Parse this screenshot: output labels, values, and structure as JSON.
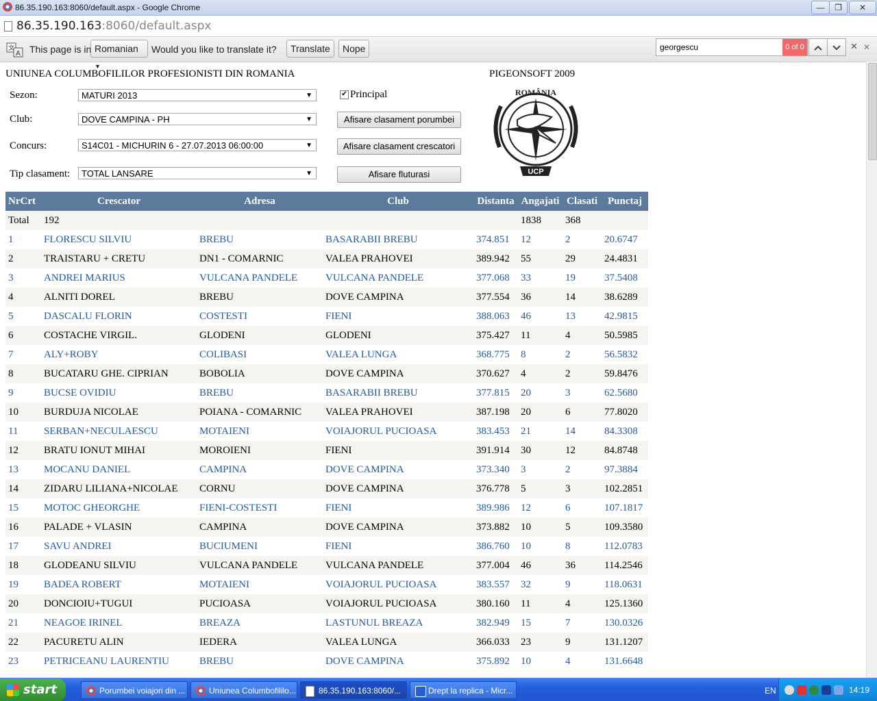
{
  "window": {
    "title": "86.35.190.163:8060/default.aspx - Google Chrome",
    "minimize": "—",
    "restore": "❐",
    "close": "✕"
  },
  "urlbar": {
    "host": "86.35.190.163",
    "path": ":8060/default.aspx"
  },
  "translate": {
    "prefix": "This page is in",
    "language": "Romanian",
    "question": "Would you like to translate it?",
    "translate_label": "Translate",
    "nope_label": "Nope"
  },
  "find": {
    "query": "georgescu",
    "count": "0 of 0",
    "close": "✕"
  },
  "header": {
    "org": "UNIUNEA COLUMBOFILILOR PROFESIONISTI DIN ROMANIA",
    "software": "PIGEONSOFT 2009"
  },
  "form": {
    "sezon_label": "Sezon:",
    "sezon_value": "MATURI 2013",
    "club_label": "Club:",
    "club_value": "DOVE CAMPINA - PH",
    "concurs_label": "Concurs:",
    "concurs_value": "S14C01 - MICHURIN 6 - 27.07.2013 06:00:00",
    "tip_label": "Tip clasament:",
    "tip_value": "TOTAL LANSARE",
    "principal_label": "Principal",
    "principal_checked": true,
    "btn_porumbei": "Afisare clasament porumbei",
    "btn_crescatori": "Afisare clasament crescatori",
    "btn_fluturasi": "Afisare fluturasi"
  },
  "logo": {
    "top_text": "ROMÂNIA",
    "bottom_text": "UCP"
  },
  "table": {
    "headers": [
      "NrCrt",
      "Crescator",
      "Adresa",
      "Club",
      "Distanta",
      "Angajati",
      "Clasati",
      "Punctaj"
    ],
    "total": {
      "label": "Total",
      "count": "192",
      "angajati": "1838",
      "clasati": "368"
    },
    "rows": [
      [
        "1",
        "FLORESCU SILVIU",
        "BREBU",
        "BASARABII BREBU",
        "374.851",
        "12",
        "2",
        "20.6747"
      ],
      [
        "2",
        "TRAISTARU + CRETU",
        "DN1 - COMARNIC",
        "VALEA PRAHOVEI",
        "389.942",
        "55",
        "29",
        "24.4831"
      ],
      [
        "3",
        "ANDREI MARIUS",
        "VULCANA PANDELE",
        "VULCANA PANDELE",
        "377.068",
        "33",
        "19",
        "37.5408"
      ],
      [
        "4",
        "ALNITI DOREL",
        "BREBU",
        "DOVE CAMPINA",
        "377.554",
        "36",
        "14",
        "38.6289"
      ],
      [
        "5",
        "DASCALU FLORIN",
        "COSTESTI",
        "FIENI",
        "388.063",
        "46",
        "13",
        "42.9815"
      ],
      [
        "6",
        "COSTACHE VIRGIL.",
        "GLODENI",
        "GLODENI",
        "375.427",
        "11",
        "4",
        "50.5985"
      ],
      [
        "7",
        "ALY+ROBY",
        "COLIBASI",
        "VALEA LUNGA",
        "368.775",
        "8",
        "2",
        "56.5832"
      ],
      [
        "8",
        "BUCATARU GHE. CIPRIAN",
        "BOBOLIA",
        "DOVE CAMPINA",
        "370.627",
        "4",
        "2",
        "59.8476"
      ],
      [
        "9",
        "BUCSE OVIDIU",
        "BREBU",
        "BASARABII BREBU",
        "377.815",
        "20",
        "3",
        "62.5680"
      ],
      [
        "10",
        "BURDUJA NICOLAE",
        "POIANA - COMARNIC",
        "VALEA PRAHOVEI",
        "387.198",
        "20",
        "6",
        "77.8020"
      ],
      [
        "11",
        "SERBAN+NECULAESCU",
        "MOTAIENI",
        "VOIAJORUL PUCIOASA",
        "383.453",
        "21",
        "14",
        "84.3308"
      ],
      [
        "12",
        "BRATU IONUT MIHAI",
        "MOROIENI",
        "FIENI",
        "391.914",
        "30",
        "12",
        "84.8748"
      ],
      [
        "13",
        "MOCANU DANIEL",
        "CAMPINA",
        "DOVE CAMPINA",
        "373.340",
        "3",
        "2",
        "97.3884"
      ],
      [
        "14",
        "ZIDARU LILIANA+NICOLAE",
        "CORNU",
        "DOVE CAMPINA",
        "376.778",
        "5",
        "3",
        "102.2851"
      ],
      [
        "15",
        "MOTOC GHEORGHE",
        "FIENI-COSTESTI",
        "FIENI",
        "389.986",
        "12",
        "6",
        "107.1817"
      ],
      [
        "16",
        "PALADE + VLASIN",
        "CAMPINA",
        "DOVE CAMPINA",
        "373.882",
        "10",
        "5",
        "109.3580"
      ],
      [
        "17",
        "SAVU ANDREI",
        "BUCIUMENI",
        "FIENI",
        "386.760",
        "10",
        "8",
        "112.0783"
      ],
      [
        "18",
        "GLODEANU SILVIU",
        "VULCANA PANDELE",
        "VULCANA PANDELE",
        "377.004",
        "46",
        "36",
        "114.2546"
      ],
      [
        "19",
        "BADEA ROBERT",
        "MOTAIENI",
        "VOIAJORUL PUCIOASA",
        "383.557",
        "32",
        "9",
        "118.0631"
      ],
      [
        "20",
        "DONCIOIU+TUGUI",
        "PUCIOASA",
        "VOIAJORUL PUCIOASA",
        "380.160",
        "11",
        "4",
        "125.1360"
      ],
      [
        "21",
        "NEAGOE IRINEL",
        "BREAZA",
        "LASTUNUL BREAZA",
        "382.949",
        "15",
        "7",
        "130.0326"
      ],
      [
        "22",
        "PACURETU ALIN",
        "IEDERA",
        "VALEA LUNGA",
        "366.033",
        "23",
        "9",
        "131.1207"
      ],
      [
        "23",
        "PETRICEANU LAURENTIU",
        "BREBU",
        "DOVE CAMPINA",
        "375.892",
        "10",
        "4",
        "131.6648"
      ]
    ]
  },
  "taskbar": {
    "start": "start",
    "tasks": [
      "Porumbei voiajori din ...",
      "Uniunea Columbofililo...",
      "86.35.190.163:8060/...",
      "Drept la replica - Micr..."
    ],
    "lang": "EN",
    "time": "14:19"
  }
}
